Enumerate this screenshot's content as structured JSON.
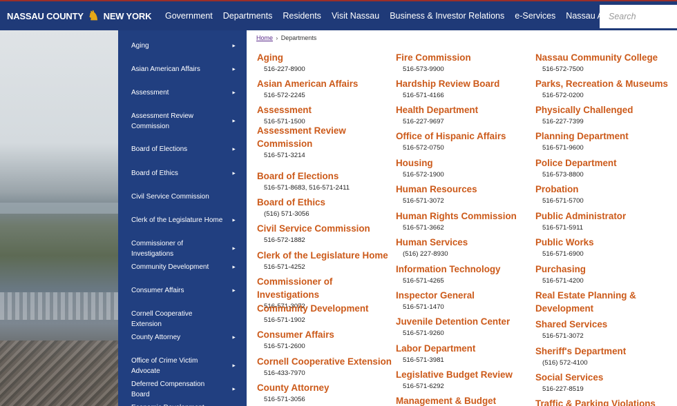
{
  "header": {
    "logo_left": "NASSAU COUNTY",
    "logo_right": "NEW YORK",
    "nav": [
      "Government",
      "Departments",
      "Residents",
      "Visit Nassau",
      "Business & Investor Relations",
      "e-Services",
      "Nassau A-Z"
    ],
    "search_placeholder": "Search"
  },
  "sidebar": {
    "items": [
      {
        "label": "Aging",
        "arrow": true
      },
      {
        "label": "Asian American Affairs",
        "arrow": true
      },
      {
        "label": "Assessment",
        "arrow": true
      },
      {
        "label": "Assessment Review Commission",
        "arrow": true
      },
      {
        "label": "Board of Elections",
        "arrow": true
      },
      {
        "label": "Board of Ethics",
        "arrow": true
      },
      {
        "label": "Civil Service Commission",
        "arrow": false
      },
      {
        "label": "Clerk of the Legislature Home",
        "arrow": true
      },
      {
        "label": "Commissioner of Investigations",
        "arrow": true
      },
      {
        "label": "Community Development",
        "arrow": true
      },
      {
        "label": "Consumer Affairs",
        "arrow": true
      },
      {
        "label": "Cornell Cooperative Extension",
        "arrow": false
      },
      {
        "label": "County Attorney",
        "arrow": true
      },
      {
        "label": "Office of Crime Victim Advocate",
        "arrow": true
      },
      {
        "label": "Deferred Compensation Board",
        "arrow": true
      },
      {
        "label": "Economic Development",
        "arrow": true
      }
    ],
    "arrow_glyph": "►"
  },
  "breadcrumb": {
    "home": "Home",
    "separator": "›",
    "current": "Departments"
  },
  "columns": [
    [
      {
        "name": "Aging",
        "phone": "516-227-8900"
      },
      {
        "name": "Asian American Affairs",
        "phone": "516-572-2245"
      },
      {
        "name": "Assessment",
        "phone": "516-571-1500"
      },
      {
        "name": "Assessment Review Commission",
        "phone": "516-571-3214"
      },
      {
        "name": "Board of Elections",
        "phone": "516-571-8683, 516-571-2411"
      },
      {
        "name": "Board of Ethics",
        "phone": "(516) 571-3056"
      },
      {
        "name": "Civil Service Commission",
        "phone": "516-572-1882"
      },
      {
        "name": "Clerk of the Legislature Home",
        "phone": "516-571-4252"
      },
      {
        "name": "Commissioner of Investigations",
        "phone": "516-571-3072"
      },
      {
        "name": "Community Development",
        "phone": "516-571-1902"
      },
      {
        "name": "Consumer Affairs",
        "phone": "516-571-2600"
      },
      {
        "name": "Cornell Cooperative Extension",
        "phone": "516-433-7970"
      },
      {
        "name": "County Attorney",
        "phone": "516-571-3056"
      }
    ],
    [
      {
        "name": "Fire Commission",
        "phone": "516-573-9900"
      },
      {
        "name": "Hardship Review Board",
        "phone": "516-571-4166"
      },
      {
        "name": "Health Department",
        "phone": "516-227-9697"
      },
      {
        "name": "Office of Hispanic Affairs",
        "phone": "516-572-0750"
      },
      {
        "name": "Housing",
        "phone": "516-572-1900"
      },
      {
        "name": "Human Resources",
        "phone": "516-571-3072"
      },
      {
        "name": "Human Rights Commission",
        "phone": "516-571-3662"
      },
      {
        "name": "Human Services",
        "phone": "(516) 227-8930"
      },
      {
        "name": "Information Technology",
        "phone": "516-571-4265"
      },
      {
        "name": "Inspector General",
        "phone": "516-571-1470"
      },
      {
        "name": "Juvenile Detention Center",
        "phone": "516-571-9260"
      },
      {
        "name": "Labor Department",
        "phone": "516-571-3981"
      },
      {
        "name": "Legislative Budget Review",
        "phone": "516-571-6292"
      },
      {
        "name": "Management & Budget",
        "phone": ""
      }
    ],
    [
      {
        "name": "Nassau Community College",
        "phone": "516-572-7500"
      },
      {
        "name": "Parks, Recreation & Museums",
        "phone": "516-572-0200"
      },
      {
        "name": "Physically Challenged",
        "phone": "516-227-7399"
      },
      {
        "name": "Planning Department",
        "phone": "516-571-9600"
      },
      {
        "name": "Police Department",
        "phone": "516-573-8800"
      },
      {
        "name": "Probation",
        "phone": "516-571-5700"
      },
      {
        "name": "Public Administrator",
        "phone": "516-571-5911"
      },
      {
        "name": "Public Works",
        "phone": "516-571-6900"
      },
      {
        "name": "Purchasing",
        "phone": "516-571-4200"
      },
      {
        "name": "Real Estate Planning & Development",
        "phone": ""
      },
      {
        "name": "Shared Services",
        "phone": "516-571-3072"
      },
      {
        "name": "Sheriff's Department",
        "phone": "(516) 572-4100"
      },
      {
        "name": "Social Services",
        "phone": "516-227-8519"
      },
      {
        "name": "Traffic & Parking Violations",
        "phone": ""
      }
    ]
  ]
}
